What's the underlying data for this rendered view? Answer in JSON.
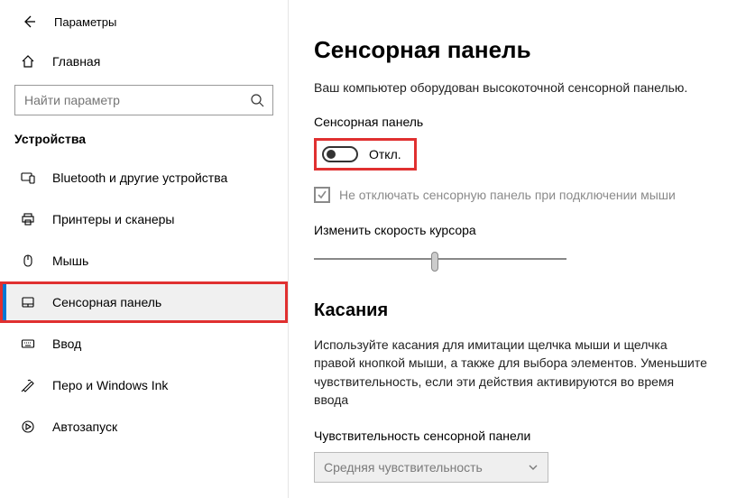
{
  "header": {
    "app_title": "Параметры"
  },
  "sidebar": {
    "home_label": "Главная",
    "search_placeholder": "Найти параметр",
    "section_title": "Устройства",
    "items": [
      {
        "label": "Bluetooth и другие устройства"
      },
      {
        "label": "Принтеры и сканеры"
      },
      {
        "label": "Мышь"
      },
      {
        "label": "Сенсорная панель"
      },
      {
        "label": "Ввод"
      },
      {
        "label": "Перо и Windows Ink"
      },
      {
        "label": "Автозапуск"
      }
    ]
  },
  "main": {
    "title": "Сенсорная панель",
    "description": "Ваш компьютер оборудован высокоточной сенсорной панелью.",
    "touchpad_label": "Сенсорная панель",
    "toggle_state_label": "Откл.",
    "checkbox_label": "Не отключать сенсорную панель при подключении мыши",
    "cursor_speed_label": "Изменить скорость курсора",
    "touches_heading": "Касания",
    "touches_paragraph": "Используйте касания для имитации щелчка мыши и щелчка правой кнопкой мыши, а также для выбора элементов. Уменьшите чувствительность, если эти действия активируются во время ввода",
    "sensitivity_label": "Чувствительность сенсорной панели",
    "sensitivity_value": "Средняя чувствительность"
  }
}
